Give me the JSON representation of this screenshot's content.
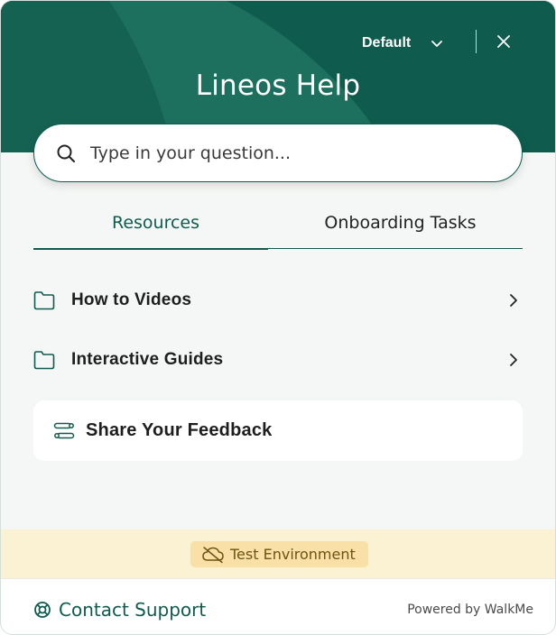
{
  "colors": {
    "brand": "#0f5c4e",
    "background": "#f5f7f6",
    "test_band": "#fbf1d3",
    "test_badge": "#f9e0a6"
  },
  "header": {
    "language_label": "Default",
    "language_icon": "chevron-down-icon",
    "close_icon": "close-icon",
    "title": "Lineos Help"
  },
  "search": {
    "icon": "search-icon",
    "placeholder": "Type in your question..."
  },
  "tabs": [
    {
      "label": "Resources",
      "active": true
    },
    {
      "label": "Onboarding Tasks",
      "active": false
    }
  ],
  "resources": [
    {
      "label": "How to Videos",
      "icon": "folder-icon",
      "trailing_icon": "chevron-right-icon"
    },
    {
      "label": "Interactive Guides",
      "icon": "folder-icon",
      "trailing_icon": "chevron-right-icon"
    }
  ],
  "feedback": {
    "icon": "feedback-icon",
    "label": "Share Your Feedback"
  },
  "environment": {
    "icon": "cloud-off-icon",
    "label": "Test Environment"
  },
  "footer": {
    "contact_icon": "lifebuoy-icon",
    "contact_label": "Contact Support",
    "powered_by": "Powered by WalkMe"
  }
}
